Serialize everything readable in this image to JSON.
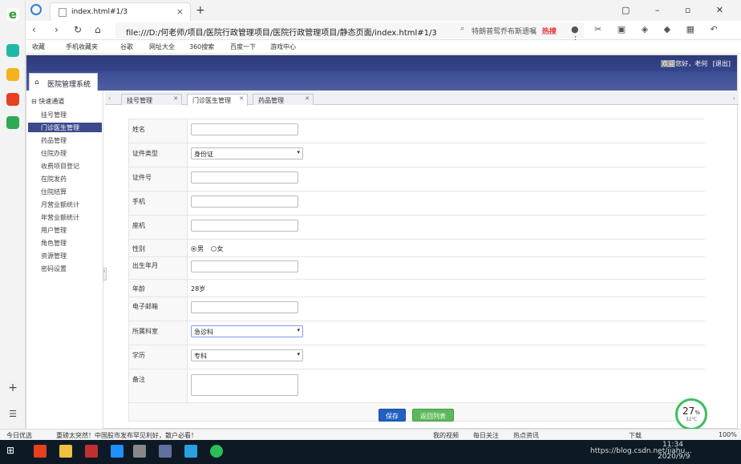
{
  "browser": {
    "tab_title": "index.html#1/3",
    "address": "file:///D:/何老师/项目/医院行政管理项目/医院行政管理项目/静态页面/index.html#1/3",
    "search_text": "特朗普鸳乔布斯遗嘱",
    "search_hot": "热搜",
    "bookmarks": [
      "收藏",
      "手机收藏夹",
      "谷歌",
      "网址大全",
      "360搜索",
      "百度一下",
      "游戏中心"
    ]
  },
  "app": {
    "title": "医院管理系统",
    "user_label": "您好，",
    "user_prefix": "欢迎",
    "user_name": "老何",
    "logout": "[退出]"
  },
  "sidebar": {
    "title": "快速通道",
    "items": [
      {
        "label": "挂号管理"
      },
      {
        "label": "门诊医生管理"
      },
      {
        "label": "药品管理"
      },
      {
        "label": "住院办理"
      },
      {
        "label": "收费项目登记"
      },
      {
        "label": "在院发药"
      },
      {
        "label": "住院结算"
      },
      {
        "label": "月营业额统计"
      },
      {
        "label": "年营业额统计"
      },
      {
        "label": "用户管理"
      },
      {
        "label": "角色管理"
      },
      {
        "label": "资源管理"
      },
      {
        "label": "密码设置"
      }
    ],
    "active_index": 1
  },
  "tabs": [
    {
      "label": "挂号管理"
    },
    {
      "label": "门诊医生管理"
    },
    {
      "label": "药品管理"
    }
  ],
  "form": {
    "name_label": "姓名",
    "idtype_label": "证件类型",
    "idtype_value": "身份证",
    "idno_label": "证件号",
    "mobile_label": "手机",
    "phone_label": "座机",
    "gender_label": "性别",
    "gender_male": "男",
    "gender_female": "女",
    "birth_label": "出生年月",
    "age_label": "年龄",
    "age_value": "28岁",
    "email_label": "电子邮箱",
    "dept_label": "所属科室",
    "dept_value": "急诊科",
    "edu_label": "学历",
    "edu_value": "专科",
    "note_label": "备注",
    "save": "保存",
    "back": "返回列表"
  },
  "gauge": {
    "percent": "27",
    "unit": "%",
    "temp": "32℃"
  },
  "statusbar": {
    "left": "今日优选",
    "news": "重磅太突然！中国股市发布罕见利好，散户必看！",
    "video": "我的视频",
    "daily": "每日关注",
    "hot": "热点资讯",
    "download": "下载",
    "zoom": "100%"
  },
  "taskbar": {
    "time": "11:34",
    "date": "2020/9/9",
    "watermark": "https://blog.csdn.net/jiahu..."
  }
}
